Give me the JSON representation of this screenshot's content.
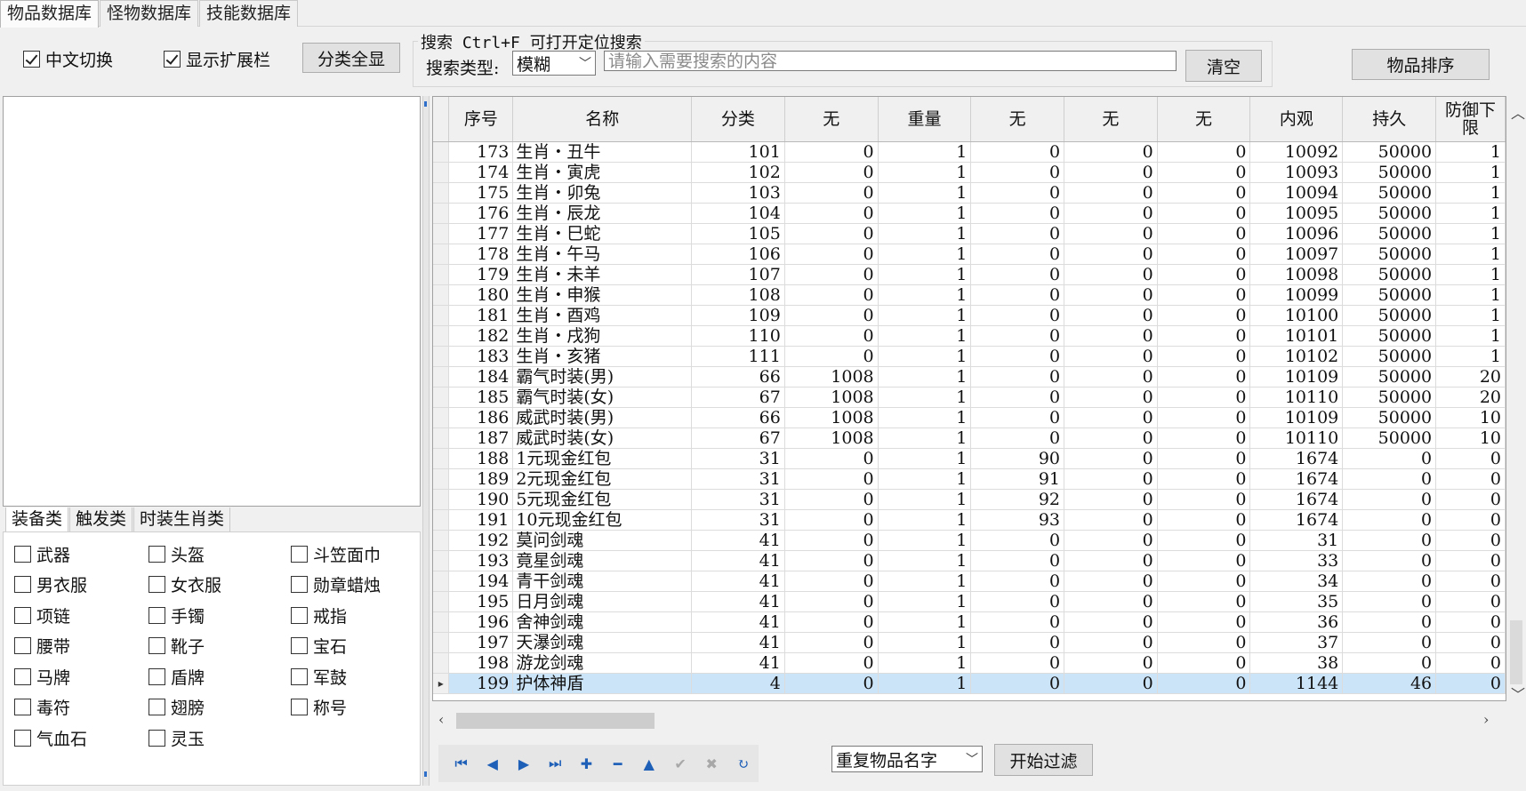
{
  "tabs": [
    "物品数据库",
    "怪物数据库",
    "技能数据库"
  ],
  "toolbar": {
    "chinese_toggle": "中文切换",
    "show_ext": "显示扩展栏",
    "show_all_btn": "分类全显",
    "search_legend": "搜索  Ctrl+F 可打开定位搜索",
    "search_type_label": "搜索类型:",
    "search_type_value": "模糊",
    "search_placeholder": "请输入需要搜索的内容",
    "clear_btn": "清空",
    "sort_btn": "物品排序"
  },
  "category_tabs": [
    "装备类",
    "触发类",
    "时装生肖类"
  ],
  "categories": [
    [
      "武器",
      "头盔",
      "斗笠面巾"
    ],
    [
      "男衣服",
      "女衣服",
      "勋章蜡烛"
    ],
    [
      "项链",
      "手镯",
      "戒指"
    ],
    [
      "腰带",
      "靴子",
      "宝石"
    ],
    [
      "马牌",
      "盾牌",
      "军鼓"
    ],
    [
      "毒符",
      "翅膀",
      "称号"
    ],
    [
      "气血石",
      "灵玉"
    ]
  ],
  "grid": {
    "columns": [
      "序号",
      "名称",
      "分类",
      "无",
      "重量",
      "无",
      "无",
      "无",
      "内观",
      "持久",
      "防御下限"
    ],
    "selected_index": 26,
    "rows": [
      [
        "173",
        "生肖・丑牛",
        "101",
        "0",
        "1",
        "0",
        "0",
        "0",
        "10092",
        "50000",
        "1"
      ],
      [
        "174",
        "生肖・寅虎",
        "102",
        "0",
        "1",
        "0",
        "0",
        "0",
        "10093",
        "50000",
        "1"
      ],
      [
        "175",
        "生肖・卯兔",
        "103",
        "0",
        "1",
        "0",
        "0",
        "0",
        "10094",
        "50000",
        "1"
      ],
      [
        "176",
        "生肖・辰龙",
        "104",
        "0",
        "1",
        "0",
        "0",
        "0",
        "10095",
        "50000",
        "1"
      ],
      [
        "177",
        "生肖・巳蛇",
        "105",
        "0",
        "1",
        "0",
        "0",
        "0",
        "10096",
        "50000",
        "1"
      ],
      [
        "178",
        "生肖・午马",
        "106",
        "0",
        "1",
        "0",
        "0",
        "0",
        "10097",
        "50000",
        "1"
      ],
      [
        "179",
        "生肖・未羊",
        "107",
        "0",
        "1",
        "0",
        "0",
        "0",
        "10098",
        "50000",
        "1"
      ],
      [
        "180",
        "生肖・申猴",
        "108",
        "0",
        "1",
        "0",
        "0",
        "0",
        "10099",
        "50000",
        "1"
      ],
      [
        "181",
        "生肖・酉鸡",
        "109",
        "0",
        "1",
        "0",
        "0",
        "0",
        "10100",
        "50000",
        "1"
      ],
      [
        "182",
        "生肖・戌狗",
        "110",
        "0",
        "1",
        "0",
        "0",
        "0",
        "10101",
        "50000",
        "1"
      ],
      [
        "183",
        "生肖・亥猪",
        "111",
        "0",
        "1",
        "0",
        "0",
        "0",
        "10102",
        "50000",
        "1"
      ],
      [
        "184",
        "霸气时装(男)",
        "66",
        "1008",
        "1",
        "0",
        "0",
        "0",
        "10109",
        "50000",
        "20"
      ],
      [
        "185",
        "霸气时装(女)",
        "67",
        "1008",
        "1",
        "0",
        "0",
        "0",
        "10110",
        "50000",
        "20"
      ],
      [
        "186",
        "威武时装(男)",
        "66",
        "1008",
        "1",
        "0",
        "0",
        "0",
        "10109",
        "50000",
        "10"
      ],
      [
        "187",
        "威武时装(女)",
        "67",
        "1008",
        "1",
        "0",
        "0",
        "0",
        "10110",
        "50000",
        "10"
      ],
      [
        "188",
        "1元现金红包",
        "31",
        "0",
        "1",
        "90",
        "0",
        "0",
        "1674",
        "0",
        "0"
      ],
      [
        "189",
        "2元现金红包",
        "31",
        "0",
        "1",
        "91",
        "0",
        "0",
        "1674",
        "0",
        "0"
      ],
      [
        "190",
        "5元现金红包",
        "31",
        "0",
        "1",
        "92",
        "0",
        "0",
        "1674",
        "0",
        "0"
      ],
      [
        "191",
        "10元现金红包",
        "31",
        "0",
        "1",
        "93",
        "0",
        "0",
        "1674",
        "0",
        "0"
      ],
      [
        "192",
        "莫问剑魂",
        "41",
        "0",
        "1",
        "0",
        "0",
        "0",
        "31",
        "0",
        "0"
      ],
      [
        "193",
        "竟星剑魂",
        "41",
        "0",
        "1",
        "0",
        "0",
        "0",
        "33",
        "0",
        "0"
      ],
      [
        "194",
        "青干剑魂",
        "41",
        "0",
        "1",
        "0",
        "0",
        "0",
        "34",
        "0",
        "0"
      ],
      [
        "195",
        "日月剑魂",
        "41",
        "0",
        "1",
        "0",
        "0",
        "0",
        "35",
        "0",
        "0"
      ],
      [
        "196",
        "舍神剑魂",
        "41",
        "0",
        "1",
        "0",
        "0",
        "0",
        "36",
        "0",
        "0"
      ],
      [
        "197",
        "天瀑剑魂",
        "41",
        "0",
        "1",
        "0",
        "0",
        "0",
        "37",
        "0",
        "0"
      ],
      [
        "198",
        "游龙剑魂",
        "41",
        "0",
        "1",
        "0",
        "0",
        "0",
        "38",
        "0",
        "0"
      ],
      [
        "199",
        "护体神盾",
        "4",
        "0",
        "1",
        "0",
        "0",
        "0",
        "1144",
        "46",
        "0"
      ]
    ]
  },
  "navigator": [
    {
      "icon": "first-record-icon",
      "glyph": "⏮",
      "enabled": true
    },
    {
      "icon": "prior-record-icon",
      "glyph": "◀",
      "enabled": true
    },
    {
      "icon": "next-record-icon",
      "glyph": "▶",
      "enabled": true
    },
    {
      "icon": "last-record-icon",
      "glyph": "⏭",
      "enabled": true
    },
    {
      "icon": "insert-record-icon",
      "glyph": "✚",
      "enabled": true
    },
    {
      "icon": "delete-record-icon",
      "glyph": "━",
      "enabled": true
    },
    {
      "icon": "edit-record-icon",
      "glyph": "▲",
      "enabled": true
    },
    {
      "icon": "post-record-icon",
      "glyph": "✔",
      "enabled": false
    },
    {
      "icon": "cancel-record-icon",
      "glyph": "✖",
      "enabled": false
    },
    {
      "icon": "refresh-record-icon",
      "glyph": "↻",
      "enabled": true
    }
  ],
  "filter": {
    "select_value": "重复物品名字",
    "start_btn": "开始过滤"
  }
}
